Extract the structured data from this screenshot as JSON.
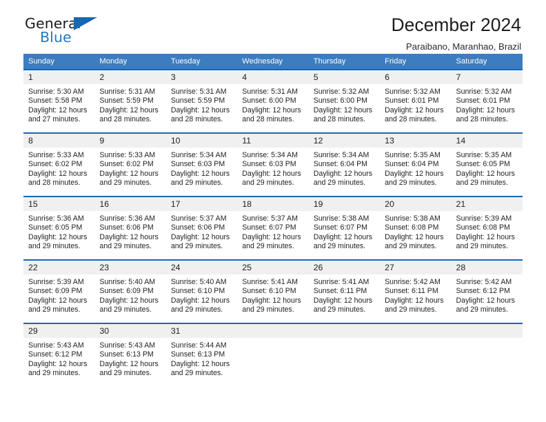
{
  "brand": {
    "name_part1": "General",
    "name_part2": "Blue",
    "triangle_color": "#1668b3",
    "blue_color": "#1f78c1"
  },
  "header": {
    "title": "December 2024",
    "location": "Paraibano, Maranhao, Brazil"
  },
  "theme": {
    "header_bg": "#3b7dc0",
    "row_border": "#1668b3",
    "daynum_bg": "#f0f0f0"
  },
  "calendar": {
    "weekday_headers": [
      "Sunday",
      "Monday",
      "Tuesday",
      "Wednesday",
      "Thursday",
      "Friday",
      "Saturday"
    ],
    "labels": {
      "sunrise": "Sunrise:",
      "sunset": "Sunset:",
      "daylight": "Daylight:"
    },
    "weeks": [
      [
        {
          "day": "1",
          "sunrise": "Sunrise: 5:30 AM",
          "sunset": "Sunset: 5:58 PM",
          "daylight1": "Daylight: 12 hours",
          "daylight2": "and 27 minutes."
        },
        {
          "day": "2",
          "sunrise": "Sunrise: 5:31 AM",
          "sunset": "Sunset: 5:59 PM",
          "daylight1": "Daylight: 12 hours",
          "daylight2": "and 28 minutes."
        },
        {
          "day": "3",
          "sunrise": "Sunrise: 5:31 AM",
          "sunset": "Sunset: 5:59 PM",
          "daylight1": "Daylight: 12 hours",
          "daylight2": "and 28 minutes."
        },
        {
          "day": "4",
          "sunrise": "Sunrise: 5:31 AM",
          "sunset": "Sunset: 6:00 PM",
          "daylight1": "Daylight: 12 hours",
          "daylight2": "and 28 minutes."
        },
        {
          "day": "5",
          "sunrise": "Sunrise: 5:32 AM",
          "sunset": "Sunset: 6:00 PM",
          "daylight1": "Daylight: 12 hours",
          "daylight2": "and 28 minutes."
        },
        {
          "day": "6",
          "sunrise": "Sunrise: 5:32 AM",
          "sunset": "Sunset: 6:01 PM",
          "daylight1": "Daylight: 12 hours",
          "daylight2": "and 28 minutes."
        },
        {
          "day": "7",
          "sunrise": "Sunrise: 5:32 AM",
          "sunset": "Sunset: 6:01 PM",
          "daylight1": "Daylight: 12 hours",
          "daylight2": "and 28 minutes."
        }
      ],
      [
        {
          "day": "8",
          "sunrise": "Sunrise: 5:33 AM",
          "sunset": "Sunset: 6:02 PM",
          "daylight1": "Daylight: 12 hours",
          "daylight2": "and 28 minutes."
        },
        {
          "day": "9",
          "sunrise": "Sunrise: 5:33 AM",
          "sunset": "Sunset: 6:02 PM",
          "daylight1": "Daylight: 12 hours",
          "daylight2": "and 29 minutes."
        },
        {
          "day": "10",
          "sunrise": "Sunrise: 5:34 AM",
          "sunset": "Sunset: 6:03 PM",
          "daylight1": "Daylight: 12 hours",
          "daylight2": "and 29 minutes."
        },
        {
          "day": "11",
          "sunrise": "Sunrise: 5:34 AM",
          "sunset": "Sunset: 6:03 PM",
          "daylight1": "Daylight: 12 hours",
          "daylight2": "and 29 minutes."
        },
        {
          "day": "12",
          "sunrise": "Sunrise: 5:34 AM",
          "sunset": "Sunset: 6:04 PM",
          "daylight1": "Daylight: 12 hours",
          "daylight2": "and 29 minutes."
        },
        {
          "day": "13",
          "sunrise": "Sunrise: 5:35 AM",
          "sunset": "Sunset: 6:04 PM",
          "daylight1": "Daylight: 12 hours",
          "daylight2": "and 29 minutes."
        },
        {
          "day": "14",
          "sunrise": "Sunrise: 5:35 AM",
          "sunset": "Sunset: 6:05 PM",
          "daylight1": "Daylight: 12 hours",
          "daylight2": "and 29 minutes."
        }
      ],
      [
        {
          "day": "15",
          "sunrise": "Sunrise: 5:36 AM",
          "sunset": "Sunset: 6:05 PM",
          "daylight1": "Daylight: 12 hours",
          "daylight2": "and 29 minutes."
        },
        {
          "day": "16",
          "sunrise": "Sunrise: 5:36 AM",
          "sunset": "Sunset: 6:06 PM",
          "daylight1": "Daylight: 12 hours",
          "daylight2": "and 29 minutes."
        },
        {
          "day": "17",
          "sunrise": "Sunrise: 5:37 AM",
          "sunset": "Sunset: 6:06 PM",
          "daylight1": "Daylight: 12 hours",
          "daylight2": "and 29 minutes."
        },
        {
          "day": "18",
          "sunrise": "Sunrise: 5:37 AM",
          "sunset": "Sunset: 6:07 PM",
          "daylight1": "Daylight: 12 hours",
          "daylight2": "and 29 minutes."
        },
        {
          "day": "19",
          "sunrise": "Sunrise: 5:38 AM",
          "sunset": "Sunset: 6:07 PM",
          "daylight1": "Daylight: 12 hours",
          "daylight2": "and 29 minutes."
        },
        {
          "day": "20",
          "sunrise": "Sunrise: 5:38 AM",
          "sunset": "Sunset: 6:08 PM",
          "daylight1": "Daylight: 12 hours",
          "daylight2": "and 29 minutes."
        },
        {
          "day": "21",
          "sunrise": "Sunrise: 5:39 AM",
          "sunset": "Sunset: 6:08 PM",
          "daylight1": "Daylight: 12 hours",
          "daylight2": "and 29 minutes."
        }
      ],
      [
        {
          "day": "22",
          "sunrise": "Sunrise: 5:39 AM",
          "sunset": "Sunset: 6:09 PM",
          "daylight1": "Daylight: 12 hours",
          "daylight2": "and 29 minutes."
        },
        {
          "day": "23",
          "sunrise": "Sunrise: 5:40 AM",
          "sunset": "Sunset: 6:09 PM",
          "daylight1": "Daylight: 12 hours",
          "daylight2": "and 29 minutes."
        },
        {
          "day": "24",
          "sunrise": "Sunrise: 5:40 AM",
          "sunset": "Sunset: 6:10 PM",
          "daylight1": "Daylight: 12 hours",
          "daylight2": "and 29 minutes."
        },
        {
          "day": "25",
          "sunrise": "Sunrise: 5:41 AM",
          "sunset": "Sunset: 6:10 PM",
          "daylight1": "Daylight: 12 hours",
          "daylight2": "and 29 minutes."
        },
        {
          "day": "26",
          "sunrise": "Sunrise: 5:41 AM",
          "sunset": "Sunset: 6:11 PM",
          "daylight1": "Daylight: 12 hours",
          "daylight2": "and 29 minutes."
        },
        {
          "day": "27",
          "sunrise": "Sunrise: 5:42 AM",
          "sunset": "Sunset: 6:11 PM",
          "daylight1": "Daylight: 12 hours",
          "daylight2": "and 29 minutes."
        },
        {
          "day": "28",
          "sunrise": "Sunrise: 5:42 AM",
          "sunset": "Sunset: 6:12 PM",
          "daylight1": "Daylight: 12 hours",
          "daylight2": "and 29 minutes."
        }
      ],
      [
        {
          "day": "29",
          "sunrise": "Sunrise: 5:43 AM",
          "sunset": "Sunset: 6:12 PM",
          "daylight1": "Daylight: 12 hours",
          "daylight2": "and 29 minutes."
        },
        {
          "day": "30",
          "sunrise": "Sunrise: 5:43 AM",
          "sunset": "Sunset: 6:13 PM",
          "daylight1": "Daylight: 12 hours",
          "daylight2": "and 29 minutes."
        },
        {
          "day": "31",
          "sunrise": "Sunrise: 5:44 AM",
          "sunset": "Sunset: 6:13 PM",
          "daylight1": "Daylight: 12 hours",
          "daylight2": "and 29 minutes."
        },
        {
          "day": "",
          "sunrise": "",
          "sunset": "",
          "daylight1": "",
          "daylight2": ""
        },
        {
          "day": "",
          "sunrise": "",
          "sunset": "",
          "daylight1": "",
          "daylight2": ""
        },
        {
          "day": "",
          "sunrise": "",
          "sunset": "",
          "daylight1": "",
          "daylight2": ""
        },
        {
          "day": "",
          "sunrise": "",
          "sunset": "",
          "daylight1": "",
          "daylight2": ""
        }
      ]
    ]
  }
}
